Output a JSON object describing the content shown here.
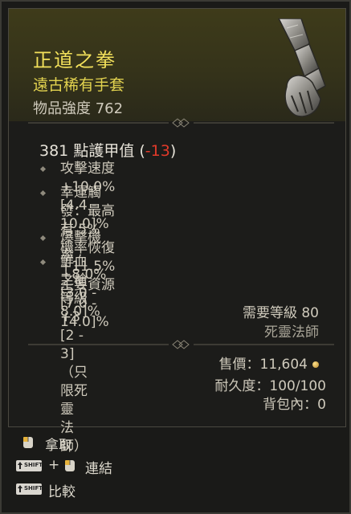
{
  "item": {
    "name": "正道之拳",
    "type": "遠古稀有手套",
    "power_label": "物品強度 762"
  },
  "armor": {
    "value": "381",
    "label": "點護甲值",
    "open": "(",
    "delta": "-13",
    "close": ")"
  },
  "affixes": [
    {
      "text": "攻擊速度 +10.0% [4.4 - 10.0]%"
    },
    {
      "text": "幸運觸發：最高有 5% 機率恢復\n+11.5% 主要資源 [7.0 - 14.0]%"
    },
    {
      "text": "爆擊機率 +8.0% [3.0 - 8.0]%"
    },
    {
      "text": "鮮血之槍等級 +3 [2 - 3]（只限死靈\n法師）"
    }
  ],
  "requirements": {
    "level": "需要等級 80",
    "class": "死靈法師"
  },
  "meta": {
    "price": "售價：11,604",
    "durability": "耐久度：100/100",
    "stash": "背包內：0"
  },
  "actions": {
    "take": "拿取",
    "link_plus": "+",
    "link": "連結",
    "compare": "比較",
    "shift_key": "SHIFT"
  },
  "colors": {
    "item_name": "#f3e15b",
    "item_type": "#e2d24f",
    "negative": "#e23a2a",
    "header_bg": "#3e3b1a"
  }
}
